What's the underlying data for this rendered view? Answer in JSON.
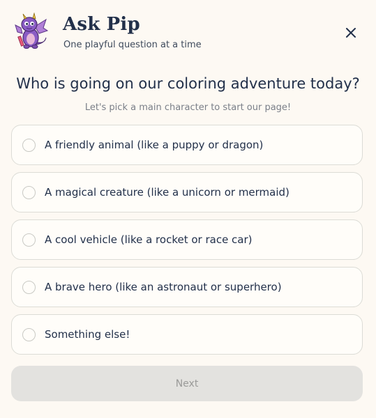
{
  "header": {
    "title": "Ask Pip",
    "subtitle": "One playful question at a time",
    "mascot_icon": "purple-dragon-mascot",
    "close_icon": "close-icon"
  },
  "question": {
    "text": "Who is going on our coloring adventure today?",
    "hint": "Let's pick a main character to start our page!"
  },
  "options": [
    {
      "label": "A friendly animal (like a puppy or dragon)"
    },
    {
      "label": "A magical creature (like a unicorn or mermaid)"
    },
    {
      "label": "A cool vehicle (like a rocket or race car)"
    },
    {
      "label": "A brave hero (like an astronaut or superhero)"
    },
    {
      "label": "Something else!"
    }
  ],
  "next_button": {
    "label": "Next",
    "enabled": false
  },
  "colors": {
    "background": "#fdf9f3",
    "text": "#22304a",
    "border": "#dcdcd6",
    "button_disabled": "#e3e2df"
  }
}
